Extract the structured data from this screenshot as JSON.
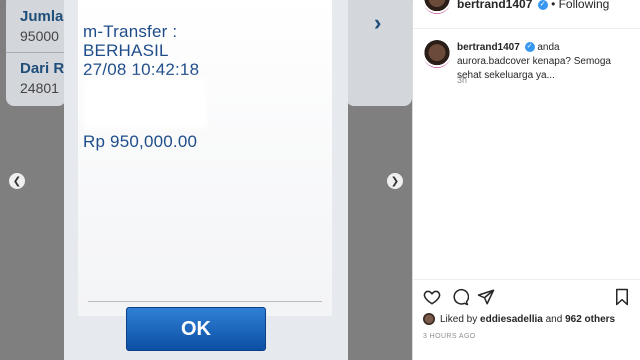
{
  "background_screen": {
    "row1_label": "Jumlah",
    "row1_value": "95000",
    "row2_label": "Dari R",
    "row2_value": "24801"
  },
  "dialog": {
    "line1": "m-Transfer :",
    "line2": "BERHASIL",
    "line3": "27/08 10:42:18",
    "amount": "Rp 950,000.00",
    "ok_label": "OK"
  },
  "viewer": {
    "prev_icon": "chevron-left-icon",
    "next_icon": "chevron-right-icon"
  },
  "post": {
    "author": "bertrand1407",
    "follow_status": "• Following",
    "comment_author": "bertrand1407",
    "comment_text": "anda aurora.badcover kenapa? Semoga sehat sekeluarga ya...",
    "comment_time": "3h",
    "likes_prefix": "Liked by",
    "likes_user": "eddiesadellia",
    "likes_and": "and",
    "likes_count": "962 others",
    "date": "3 HOURS AGO"
  },
  "colors": {
    "dialog_text": "#1e4d8a",
    "ok_button": "#1a62b8",
    "verified": "#3897f0",
    "muted": "#8e8e8e"
  }
}
